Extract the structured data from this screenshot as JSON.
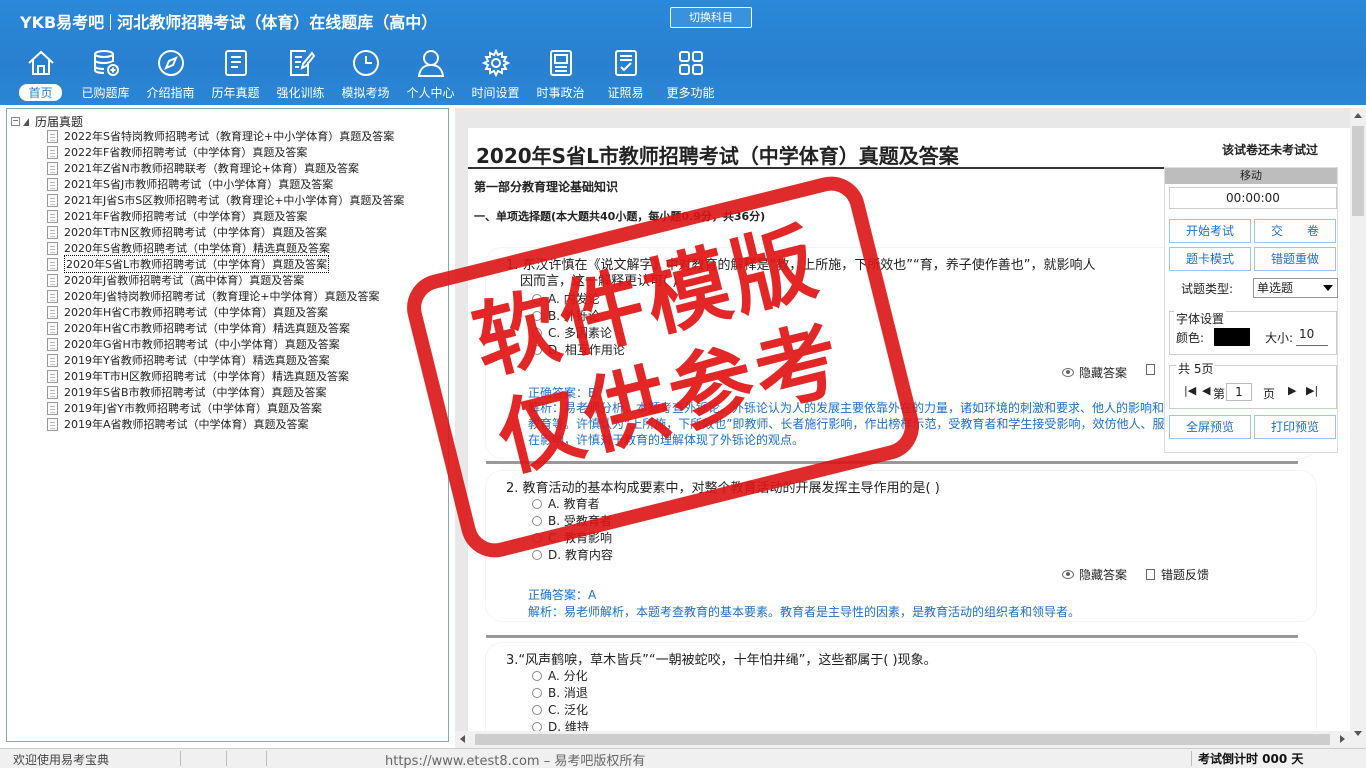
{
  "brand": {
    "logo": "YKB易考吧",
    "title": "河北教师招聘考试（体育）在线题库（高中）"
  },
  "switch_label": "切换科目",
  "toolbar": [
    {
      "label": "首页",
      "icon": "home-icon",
      "active": true
    },
    {
      "label": "已购题库",
      "icon": "database-icon"
    },
    {
      "label": "介绍指南",
      "icon": "compass-icon"
    },
    {
      "label": "历年真题",
      "icon": "list-doc-icon"
    },
    {
      "label": "强化训练",
      "icon": "edit-doc-icon"
    },
    {
      "label": "模拟考场",
      "icon": "clock-icon"
    },
    {
      "label": "个人中心",
      "icon": "user-icon"
    },
    {
      "label": "时间设置",
      "icon": "gear-icon"
    },
    {
      "label": "时事政治",
      "icon": "news-icon"
    },
    {
      "label": "证照易",
      "icon": "certificate-icon"
    },
    {
      "label": "更多功能",
      "icon": "grid-icon"
    }
  ],
  "tree": {
    "root": "历届真题",
    "items": [
      "2022年S省特岗教师招聘考试（教育理论+中小学体育）真题及答案",
      "2022年F省教师招聘考试（中学体育）真题及答案",
      "2021年Z省N市教师招聘联考（教育理论+体育）真题及答案",
      "2021年S省J市教师招聘考试（中小学体育）真题及答案",
      "2021年J省S市S区教师招聘考试（教育理论+中小学体育）真题及答案",
      "2021年F省教师招聘考试（中学体育）真题及答案",
      "2020年T市N区教师招聘考试（中学体育）真题及答案",
      "2020年S省教师招聘考试（中学体育）精选真题及答案",
      "2020年S省L市教师招聘考试（中学体育）真题及答案",
      "2020年J省教师招聘考试（高中体育）真题及答案",
      "2020年J省特岗教师招聘考试（教育理论+中学体育）真题及答案",
      "2020年H省C市教师招聘考试（中学体育）真题及答案",
      "2020年H省C市教师招聘考试（中学体育）精选真题及答案",
      "2020年G省H市教师招聘考试（中小学体育）真题及答案",
      "2019年Y省教师招聘考试（中学体育）精选真题及答案",
      "2019年T市H区教师招聘考试（中学体育）精选真题及答案",
      "2019年S省B市教师招聘考试（中学体育）真题及答案",
      "2019年J省Y市教师招聘考试（中学体育）真题及答案",
      "2019年A省教师招聘考试（中学体育）真题及答案"
    ],
    "selected_index": 8
  },
  "paper": {
    "title": "2020年S省L市教师招聘考试（中学体育）真题及答案",
    "status": "该试卷还未考试过",
    "part": "第一部分教育理论基础知识",
    "section": "一、单项选择题(本大题共40小题，每小题0.9分，共36分)"
  },
  "questions": [
    {
      "stem": "1. 东汉许慎在《说文解字》中对教育的解释是“教，上所施，下所效也”“育，养子使作善也”，就影响人",
      "stem2": "因而言，这一解释更认可(  )",
      "options": [
        "A. 内发论",
        "B. 外铄论",
        "C. 多因素论",
        "D. 相互作用论"
      ],
      "hide": "隐藏答案",
      "answer": "正确答案：B",
      "analysis": "解析：易老师分析，本题考查外铄论。外铄论认为人的发展主要依靠外在的力量，诸如环境的刺激和要求、他人的影响和学校的教育等。许慎认为“上所施，下所效也”即教师、长者施行影响，作出榜样示范，受教育者和学生接受影响，效仿他人、服从于外在影响，许慎对于教育的理解体现了外铄论的观点。"
    },
    {
      "stem": "2. 教育活动的基本构成要素中，对整个教育活动的开展发挥主导作用的是(  )",
      "options": [
        "A. 教育者",
        "B. 受教育者",
        "C. 教育影响",
        "D. 教育内容"
      ],
      "hide": "隐藏答案",
      "feedback": "错题反馈",
      "answer": "正确答案：A",
      "analysis": "解析：易老师解析，本题考查教育的基本要素。教育者是主导性的因素，是教育活动的组织者和领导者。"
    },
    {
      "stem": "3.“风声鹤唳，草木皆兵”“一朝被蛇咬，十年怕井绳”，这些都属于(  )现象。",
      "options": [
        "A. 分化",
        "B. 消退",
        "C. 泛化",
        "D. 维持"
      ]
    }
  ],
  "panel": {
    "title": "移动",
    "timer": "00:00:00",
    "start": "开始考试",
    "submit": "交　　卷",
    "card_mode": "题卡模式",
    "redo": "错题重做",
    "qtype_label": "试题类型:",
    "qtype_value": "单选题",
    "font_title": "字体设置",
    "color_label": "颜色:",
    "size_label": "大小:",
    "size_value": "10",
    "pages": "共 5页",
    "page_prefix": "第",
    "page_value": "1",
    "page_suffix": "页",
    "fullscreen": "全屏预览",
    "print": "打印预览"
  },
  "stamp": {
    "line1": "软件模版",
    "line2": "仅供参考"
  },
  "status": {
    "welcome": "欢迎使用易考宝典",
    "copyright": "https://www.etest8.com – 易考吧版权所有",
    "countdown": "考试倒计时 000 天"
  },
  "colors": {
    "header": "#2a7fd0",
    "accent": "#1e6fc8",
    "stamp": "#e01414"
  }
}
